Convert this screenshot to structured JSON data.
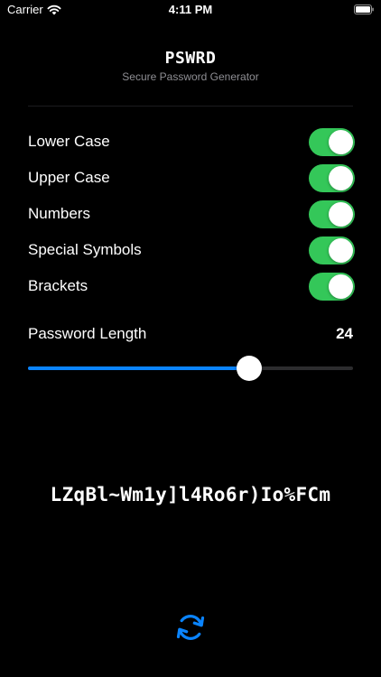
{
  "status_bar": {
    "carrier": "Carrier",
    "time": "4:11 PM"
  },
  "header": {
    "title": "PSWRD",
    "subtitle": "Secure Password Generator"
  },
  "options": [
    {
      "label": "Lower Case",
      "enabled": true
    },
    {
      "label": "Upper Case",
      "enabled": true
    },
    {
      "label": "Numbers",
      "enabled": true
    },
    {
      "label": "Special Symbols",
      "enabled": true
    },
    {
      "label": "Brackets",
      "enabled": true
    }
  ],
  "length": {
    "label": "Password Length",
    "value": "24",
    "fraction": 0.68
  },
  "password": "LZqBl~Wm1y]l4Ro6r)Io%FCm",
  "colors": {
    "toggle_on": "#34c759",
    "accent": "#0a84ff",
    "background": "#000000"
  },
  "icons": {
    "refresh": "refresh-icon"
  }
}
